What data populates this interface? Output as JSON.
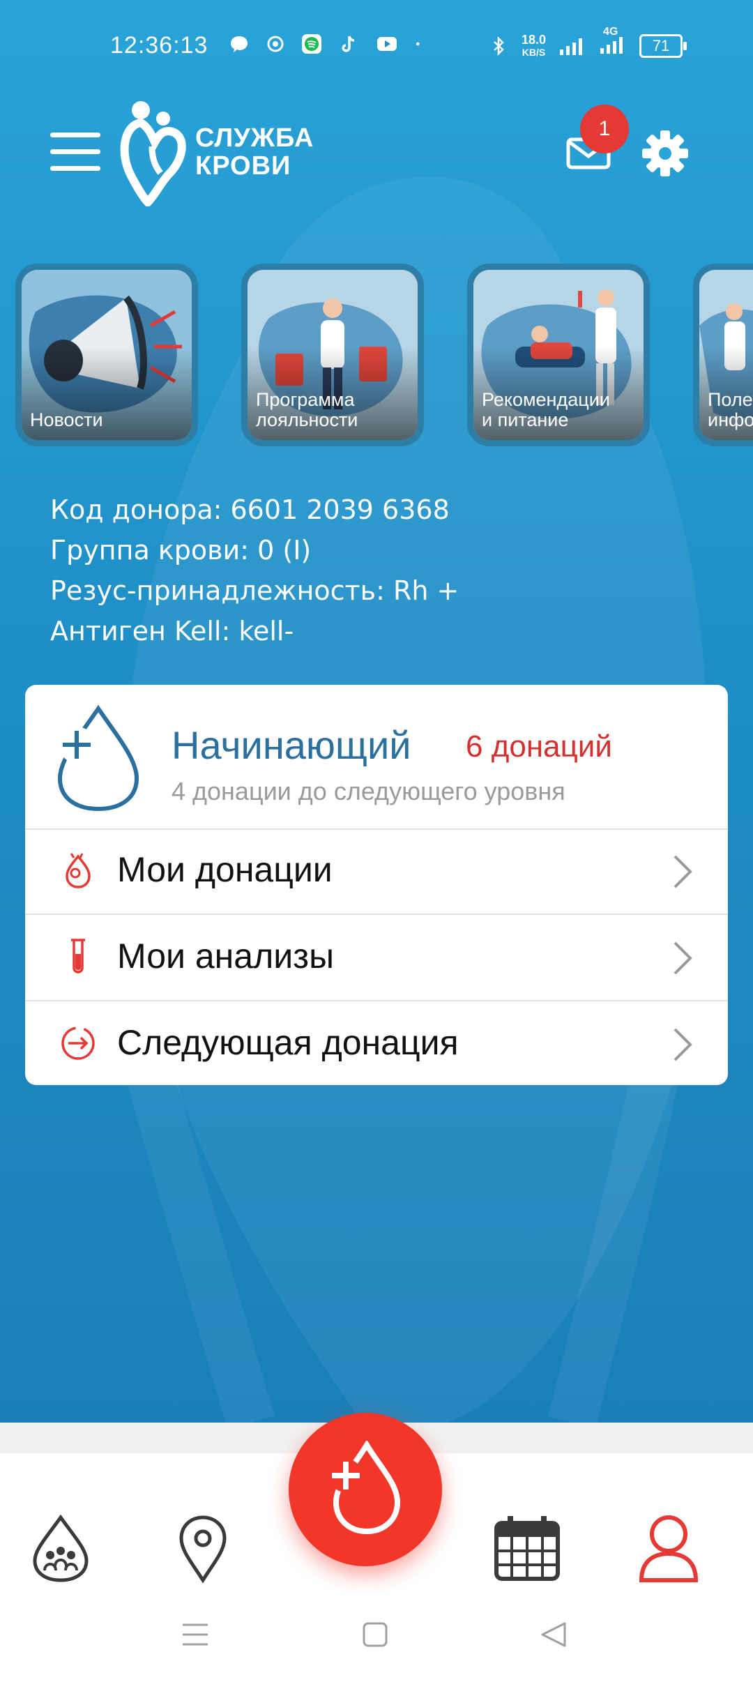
{
  "status_bar": {
    "time": "12:36:13",
    "net_speed_value": "18.0",
    "net_speed_unit": "KB/S",
    "network_type": "4G",
    "battery": "71"
  },
  "header": {
    "logo_line1": "СЛУЖБА",
    "logo_line2": "КРОВИ",
    "mail_badge": "1"
  },
  "stories": [
    {
      "caption_line1": "Новости",
      "caption_line2": ""
    },
    {
      "caption_line1": "Программа",
      "caption_line2": "лояльности"
    },
    {
      "caption_line1": "Рекомендации",
      "caption_line2": "и питание"
    },
    {
      "caption_line1": "Поле",
      "caption_line2": "инфо"
    }
  ],
  "donor": {
    "code": "Код донора: 6601 2039 6368",
    "blood_group": "Группа крови: 0 (I)",
    "rhesus": "Резус-принадлежность: Rh +",
    "kell": "Антиген Kell: kell-"
  },
  "level": {
    "title": "Начинающий",
    "count": "6 донаций",
    "subtitle": "4 донации  до следующего уровня"
  },
  "menu": [
    {
      "label": "Мои донации",
      "icon": "donation-icon"
    },
    {
      "label": "Мои анализы",
      "icon": "test-tube-icon"
    },
    {
      "label": "Следующая донация",
      "icon": "next-arrow-icon"
    }
  ],
  "colors": {
    "primary_blue": "#1f8fc7",
    "accent_red": "#f2362a",
    "level_blue": "#2a6f9e",
    "count_red": "#d2312f"
  }
}
